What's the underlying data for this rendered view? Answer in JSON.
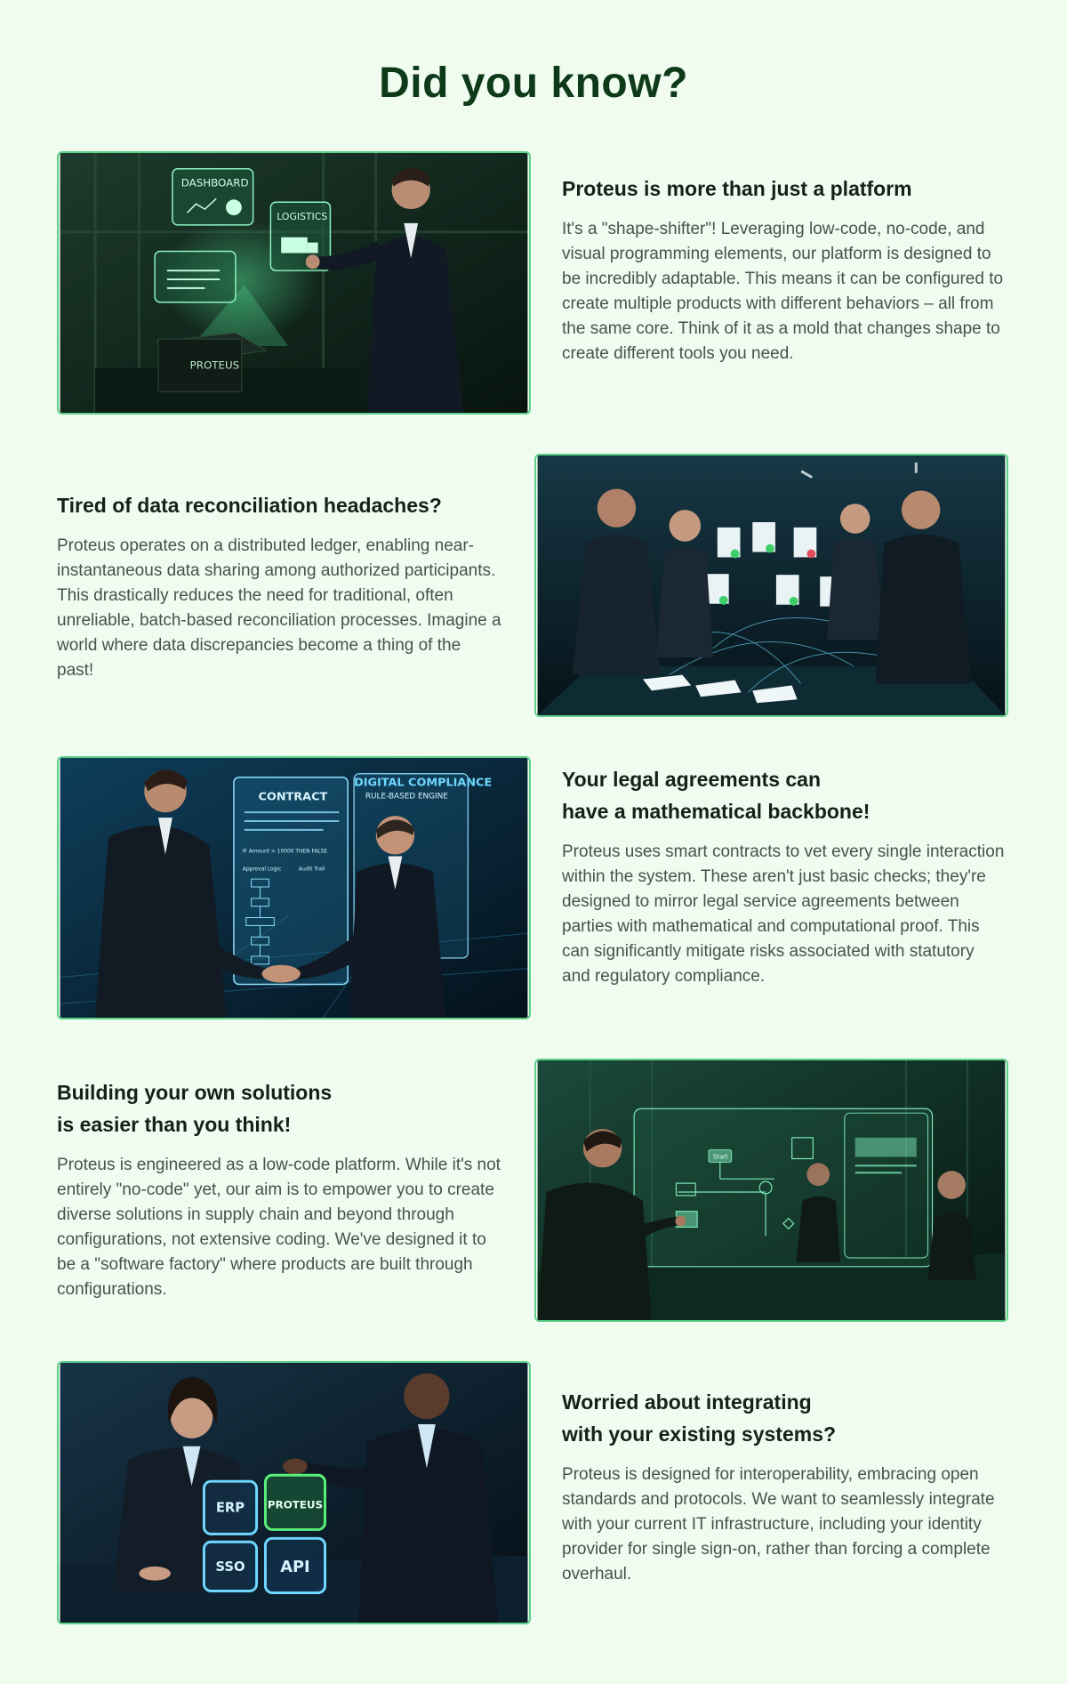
{
  "page": {
    "title": "Did you know?"
  },
  "sections": [
    {
      "heading_lines": [
        "Proteus is more than just a platform"
      ],
      "body": "It's a \"shape-shifter\"! Leveraging low-code, no-code, and visual programming elements, our platform is designed to be incredibly adaptable. This means it can be configured to create multiple products with different behaviors – all from the same core. Think of it as a mold that changes shape to create different tools you need.",
      "image_labels": [
        "DASHBOARD",
        "LOGISTICS",
        "PROTEUS"
      ]
    },
    {
      "heading_lines": [
        "Tired of data reconciliation headaches?"
      ],
      "body": "Proteus operates on a distributed ledger, enabling near-instantaneous data sharing among authorized participants. This drastically reduces the need for traditional, often unreliable, batch-based reconciliation processes. Imagine a world where data discrepancies become a thing of the past!",
      "image_labels": []
    },
    {
      "heading_lines": [
        "Your legal agreements can",
        "have a mathematical backbone!"
      ],
      "body": "Proteus uses smart contracts to vet every single interaction within the system. These aren't just basic checks; they're designed to mirror legal service agreements between parties with mathematical and computational proof. This can significantly mitigate risks associated with statutory and regulatory compliance.",
      "image_labels": [
        "CONTRACT",
        "DIGITAL COMPLIANCE",
        "RULE-BASED ENGINE",
        "IF Amount > 10000   THEN FALSE",
        "Approval Logic",
        "Audit Trail"
      ]
    },
    {
      "heading_lines": [
        "Building your own solutions",
        "is easier than you think!"
      ],
      "body": "Proteus is engineered as a low-code platform. While it's not entirely \"no-code\" yet, our aim is to empower you to create diverse solutions in supply chain and beyond through configurations, not extensive coding. We've designed it to be a \"software factory\" where products are built through configurations.",
      "image_labels": [
        "Start"
      ]
    },
    {
      "heading_lines": [
        "Worried about integrating",
        "with your existing systems?"
      ],
      "body": "Proteus is designed for interoperability, embracing open standards and protocols. We want to seamlessly integrate with your current IT infrastructure, including your identity provider for single sign-on, rather than forcing a complete overhaul.",
      "image_labels": [
        "ERP",
        "PROTEUS",
        "SSO",
        "API"
      ]
    }
  ],
  "colors": {
    "background": "#effcef",
    "title": "#0f3a1a",
    "image_border": "#5fd08a",
    "glow_green": "#59f0a0",
    "glow_blue": "#6fd8ff"
  }
}
